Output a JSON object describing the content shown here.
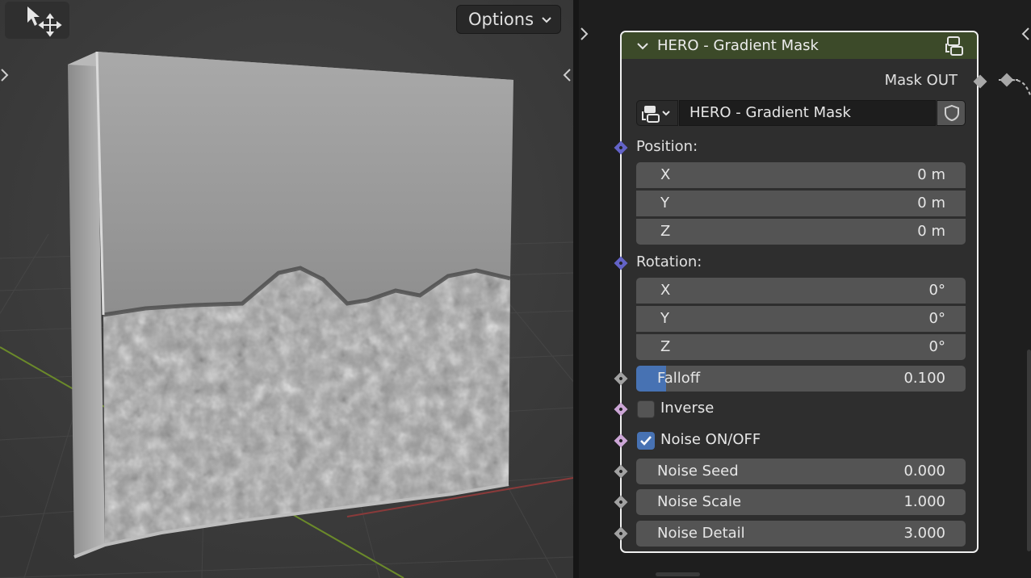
{
  "viewport": {
    "options_label": "Options"
  },
  "node": {
    "title": "HERO - Gradient Mask",
    "output_label": "Mask OUT",
    "group_name": "HERO - Gradient Mask",
    "position": {
      "label": "Position:",
      "x": {
        "label": "X",
        "value": "0 m"
      },
      "y": {
        "label": "Y",
        "value": "0 m"
      },
      "z": {
        "label": "Z",
        "value": "0 m"
      }
    },
    "rotation": {
      "label": "Rotation:",
      "x": {
        "label": "X",
        "value": "0°"
      },
      "y": {
        "label": "Y",
        "value": "0°"
      },
      "z": {
        "label": "Z",
        "value": "0°"
      }
    },
    "falloff": {
      "label": "Falloff",
      "value": "0.100",
      "fill_fraction": 0.09
    },
    "inverse": {
      "label": "Inverse",
      "checked": false
    },
    "noise_toggle": {
      "label": "Noise ON/OFF",
      "checked": true
    },
    "noise_seed": {
      "label": "Noise Seed",
      "value": "0.000"
    },
    "noise_scale": {
      "label": "Noise Scale",
      "value": "1.000"
    },
    "noise_detail": {
      "label": "Noise Detail",
      "value": "3.000"
    }
  },
  "colors": {
    "header": "#3c4a29",
    "vector_socket": "#6363c7",
    "float_socket": "#a1a1a1",
    "bool_socket": "#cca6d6",
    "accent": "#4772b3"
  }
}
